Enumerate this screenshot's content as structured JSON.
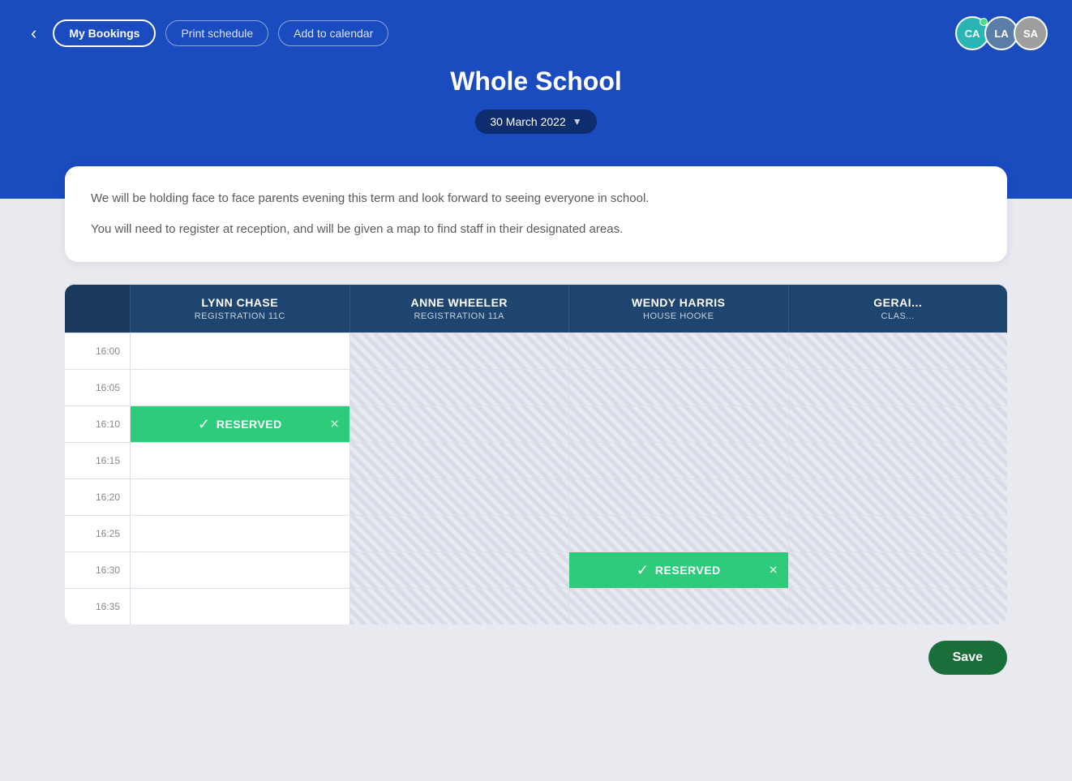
{
  "header": {
    "back_label": "‹",
    "my_bookings_label": "My Bookings",
    "print_schedule_label": "Print schedule",
    "add_to_calendar_label": "Add to calendar",
    "title": "Whole School",
    "date": "30 March 2022",
    "avatars": [
      {
        "initials": "CA",
        "color": "#2ab5b5",
        "has_dot": true
      },
      {
        "initials": "LA",
        "color": "#5b7ea8",
        "has_dot": false
      },
      {
        "initials": "SA",
        "color": "#9e9e9e",
        "has_dot": false
      }
    ]
  },
  "info_card": {
    "line1": "We will be holding face to face parents evening this term and look forward to seeing everyone in school.",
    "line2": "You will need to register at reception, and will be given a map to find staff in their designated areas."
  },
  "schedule": {
    "teachers": [
      {
        "name": "LYNN CHASE",
        "role": "REGISTRATION 11C"
      },
      {
        "name": "ANNE WHEELER",
        "role": "REGISTRATION 11A"
      },
      {
        "name": "WENDY HARRIS",
        "role": "HOUSE HOOKE"
      },
      {
        "name": "GERAI...",
        "role": "CLAS..."
      }
    ],
    "times": [
      "16:00",
      "16:05",
      "16:10",
      "16:15",
      "16:20",
      "16:25",
      "16:30",
      "16:35"
    ],
    "slots": [
      [
        false,
        false,
        false,
        false
      ],
      [
        false,
        false,
        false,
        false
      ],
      [
        "RESERVED",
        false,
        false,
        false
      ],
      [
        false,
        false,
        false,
        false
      ],
      [
        false,
        false,
        false,
        false
      ],
      [
        false,
        false,
        false,
        false
      ],
      [
        false,
        false,
        "RESERVED",
        false
      ],
      [
        false,
        false,
        false,
        false
      ]
    ],
    "slot_unavailable": [
      [
        false,
        true,
        true,
        true
      ],
      [
        false,
        true,
        true,
        true
      ],
      [
        false,
        true,
        true,
        true
      ],
      [
        false,
        true,
        true,
        true
      ],
      [
        false,
        true,
        true,
        true
      ],
      [
        false,
        true,
        true,
        true
      ],
      [
        false,
        true,
        false,
        true
      ],
      [
        false,
        true,
        true,
        true
      ]
    ]
  },
  "save_label": "Save"
}
